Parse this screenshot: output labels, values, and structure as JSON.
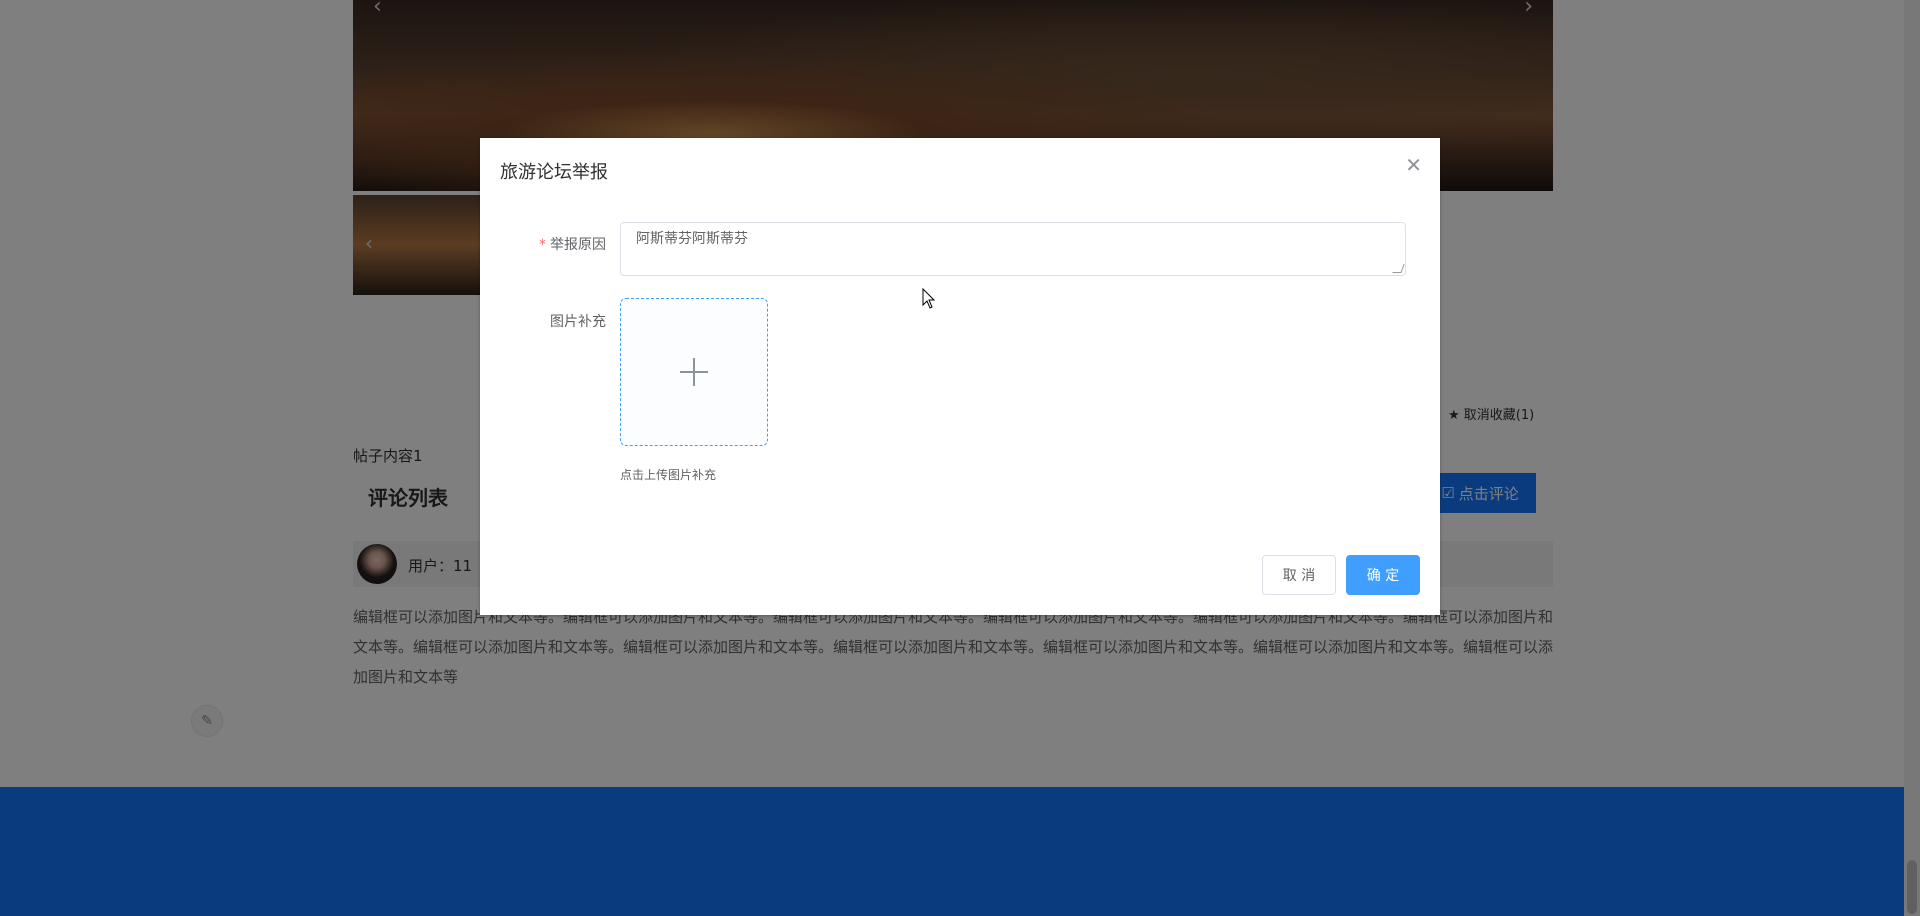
{
  "background": {
    "post_content": "帖子内容1",
    "favorite": {
      "icon": "star-icon",
      "label": "取消收藏(1)"
    },
    "comment_section": {
      "title": "评论列表",
      "comment_button": {
        "icon": "edit-icon",
        "label": "点击评论"
      }
    },
    "comment": {
      "user_label": "用户：11",
      "text": "编辑框可以添加图片和文本等。编辑框可以添加图片和文本等。编辑框可以添加图片和文本等。编辑框可以添加图片和文本等。编辑框可以添加图片和文本等。编辑框可以添加图片和文本等。编辑框可以添加图片和文本等。编辑框可以添加图片和文本等。编辑框可以添加图片和文本等。编辑框可以添加图片和文本等。编辑框可以添加图片和文本等。编辑框可以添加图片和文本等"
    },
    "footer_color": "#1677ff"
  },
  "dialog": {
    "title": "旅游论坛举报",
    "close_icon": "close-icon",
    "reason": {
      "label": "举报原因",
      "required_mark": "*",
      "value": "阿斯蒂芬阿斯蒂芬"
    },
    "image": {
      "label": "图片补充",
      "upload_icon": "plus-icon",
      "tip": "点击上传图片补充"
    },
    "cancel_label": "取 消",
    "confirm_label": "确 定",
    "accent_color": "#409eff"
  }
}
